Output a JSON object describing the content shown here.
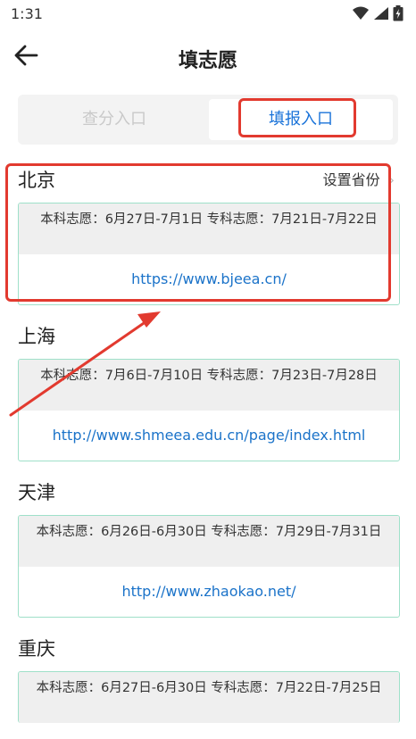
{
  "status_bar": {
    "time": "1:31"
  },
  "header": {
    "title": "填志愿"
  },
  "tabs": [
    {
      "label": "查分入口"
    },
    {
      "label": "填报入口"
    }
  ],
  "set_province_label": "设置省份",
  "regions": [
    {
      "name": "北京",
      "dates": "本科志愿：6月27日-7月1日 专科志愿：7月21日-7月22日",
      "url": "https://www.bjeea.cn/"
    },
    {
      "name": "上海",
      "dates": "本科志愿：7月6日-7月10日 专科志愿：7月23日-7月28日",
      "url": "http://www.shmeea.edu.cn/page/index.html"
    },
    {
      "name": "天津",
      "dates": "本科志愿：6月26日-6月30日 专科志愿：7月29日-7月31日",
      "url": "http://www.zhaokao.net/"
    },
    {
      "name": "重庆",
      "dates": "本科志愿：6月27日-6月30日 专科志愿：7月22日-7月25日",
      "url": ""
    }
  ],
  "colors": {
    "accent": "#1a73d9",
    "annotation": "#e23a2f",
    "card_border": "#9fe0c9"
  },
  "icons": {
    "back": "arrow-left-icon",
    "wifi": "wifi-icon",
    "signal": "signal-icon",
    "battery": "battery-icon"
  }
}
